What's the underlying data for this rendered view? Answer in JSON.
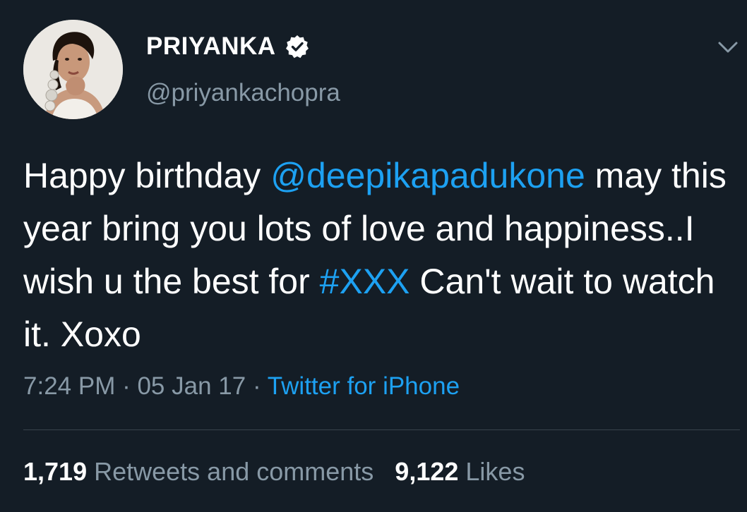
{
  "colors": {
    "background": "#141d26",
    "primary_text": "#ffffff",
    "secondary_text": "#8899a6",
    "link": "#1da1f2",
    "divider": "#38444d"
  },
  "author": {
    "display_name": "PRIYANKA",
    "handle": "@priyankachopra",
    "verified": true,
    "verified_icon": "verified-badge-icon",
    "avatar_icon": "profile-photo"
  },
  "menu": {
    "icon": "chevron-down-icon"
  },
  "tweet": {
    "text_1": "Happy birthday ",
    "mention": "@deepikapadukone",
    "text_2": " may this year bring you lots of love and happiness..I wish u the best for ",
    "hashtag": "#XXX",
    "text_3": " Can't wait to watch it. Xoxo"
  },
  "meta": {
    "time": "7:24 PM",
    "separator": " · ",
    "date": "05 Jan 17",
    "source": "Twitter for iPhone"
  },
  "stats": {
    "retweets_count": "1,719",
    "retweets_label": "Retweets and comments",
    "likes_count": "9,122",
    "likes_label": "Likes"
  }
}
